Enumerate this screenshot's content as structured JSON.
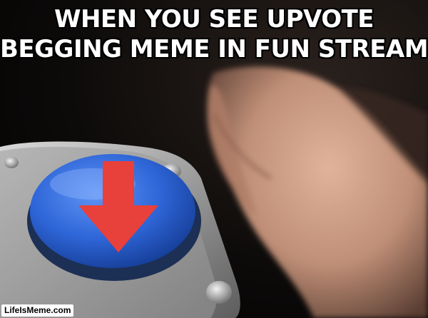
{
  "meme": {
    "caption_lines": [
      "WHEN YOU SEE UPVOTE",
      "BEGGING MEME IN FUN STREAM"
    ],
    "watermark": "LifeIsMeme.com",
    "button_color": "#2f66d8",
    "arrow_color": "#e8403a",
    "arrow_icon": "down-arrow-icon"
  }
}
